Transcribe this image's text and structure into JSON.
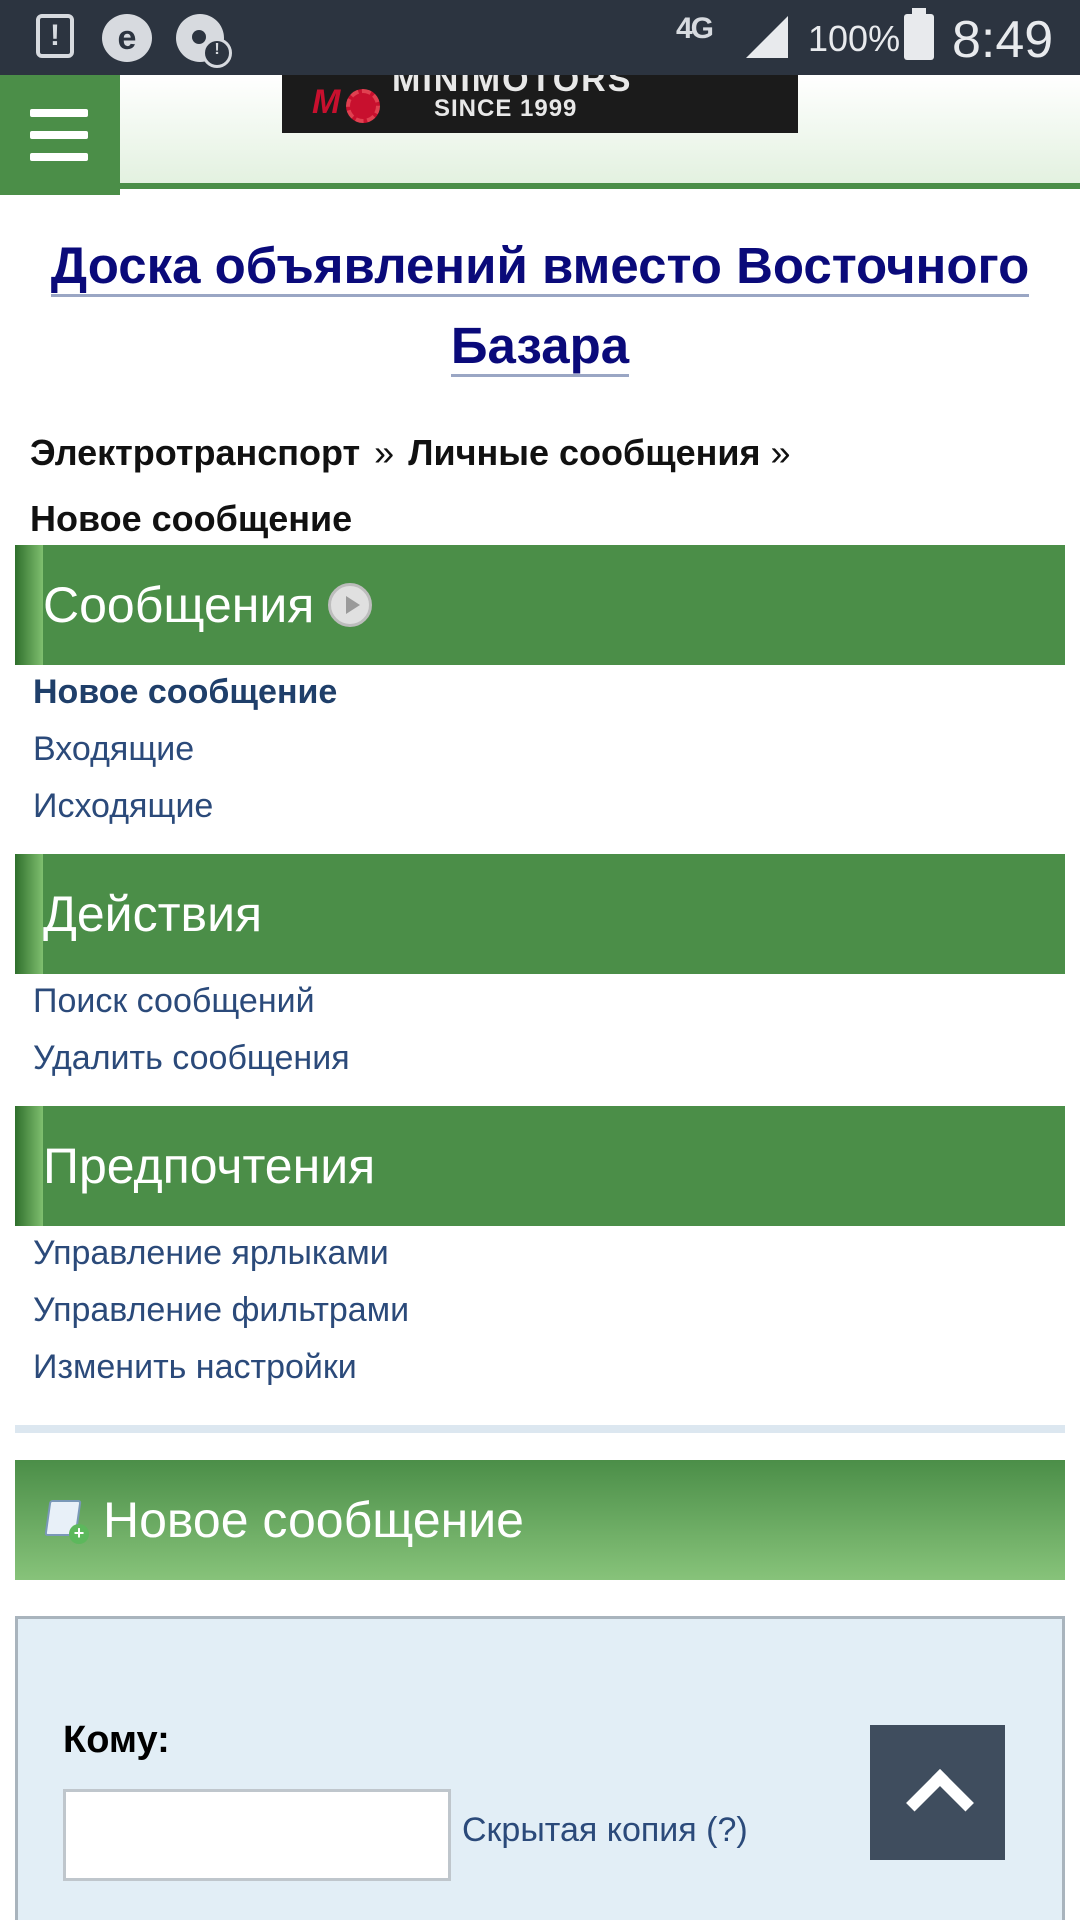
{
  "status_bar": {
    "network": "4G",
    "battery": "100%",
    "time": "8:49",
    "icons": [
      "alert-icon",
      "browser-e-icon",
      "disc-warning-icon",
      "signal-icon",
      "battery-icon"
    ]
  },
  "header": {
    "banner": {
      "brand": "MINIMOTORS",
      "since": "SINCE 1999"
    }
  },
  "site_title": "Доска объявлений вместо Восточного Базара",
  "breadcrumb": {
    "items": [
      "Электротранспорт",
      "Личные сообщения",
      "Новое сообщение"
    ],
    "separator": "»"
  },
  "sections": [
    {
      "title": "Сообщения",
      "links": [
        "Новое сообщение",
        "Входящие",
        "Исходящие"
      ]
    },
    {
      "title": "Действия",
      "links": [
        "Поиск сообщений",
        "Удалить сообщения"
      ]
    },
    {
      "title": "Предпочтения",
      "links": [
        "Управление ярлыками",
        "Управление фильтрами",
        "Изменить настройки"
      ]
    }
  ],
  "new_message": {
    "heading": "Новое сообщение",
    "to_label": "Кому:",
    "to_value": "",
    "bcc_link": "Скрытая копия (?)"
  },
  "colors": {
    "accent_green": "#4b8e48",
    "title_blue": "#0a0a7a",
    "link_blue": "#2b4a7a",
    "status_bar": "#2c3440"
  }
}
